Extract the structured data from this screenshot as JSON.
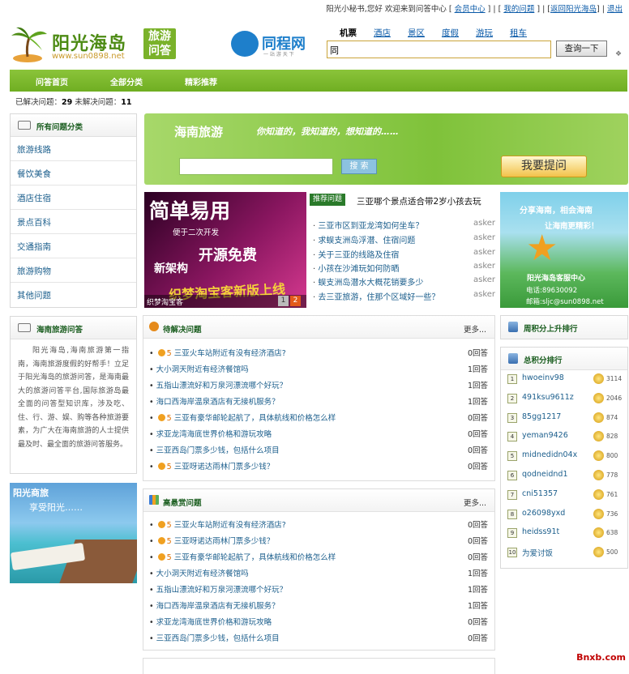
{
  "topbar": {
    "greeting": "阳光小秘书,您好 欢迎来到问答中心",
    "member_center": "会员中心",
    "my_questions": "我的问题",
    "back_home": "返回阳光海岛",
    "logout": "退出"
  },
  "header": {
    "logo_name": "阳光海岛",
    "logo_url": "www.sun0898.net",
    "badge": [
      "旅游",
      "问答"
    ],
    "partner_name": "同程网",
    "partner_slogan": "一 站 游 天 下",
    "search_tabs": [
      {
        "label": "机票",
        "active": true
      },
      {
        "label": "酒店",
        "active": false
      },
      {
        "label": "景区",
        "active": false
      },
      {
        "label": "度假",
        "active": false
      },
      {
        "label": "游玩",
        "active": false
      },
      {
        "label": "租车",
        "active": false
      }
    ],
    "search_value": "同",
    "search_button": "查询一下"
  },
  "nav": {
    "items": [
      "问答首页",
      "全部分类",
      "精彩推荐"
    ]
  },
  "stats": {
    "solved_label": "已解决问题：",
    "solved": "29",
    "unsolved_label": "未解决问题：",
    "unsolved": "11"
  },
  "categories": {
    "title": "所有问题分类",
    "items": [
      "旅游线路",
      "餐饮美食",
      "酒店住宿",
      "景点百科",
      "交通指南",
      "旅游购物",
      "其他问题"
    ]
  },
  "about": {
    "title": "海南旅游问答",
    "text": "阳光海岛,海南旅游第一指南，海南旅游度假的好帮手！立足于阳光海岛的旅游问答，是海南最大的旅游问答平台,国际旅游岛最全面的问答型知识库，涉及吃、住、行、游、娱、购等各种旅游要素，为广大在海南旅游的人士提供最及时、最全面的旅游问答服务。"
  },
  "promo": {
    "line1": "阳光商旅",
    "line2": "享受阳光……"
  },
  "banner": {
    "title": "海南旅游",
    "slogan": "你知道的，我知道的，想知道的……",
    "search_button": "搜 索",
    "ask_button": "我要提问"
  },
  "slideshow": {
    "line1": "简单易用",
    "line2": "便于二次开发",
    "line3": "开源免费",
    "line4": "新架构",
    "line5": "织梦淘宝客新版上线",
    "caption": "织梦淘宝客",
    "pages": [
      "1",
      "2"
    ]
  },
  "recommended": {
    "tag": "推荐问题",
    "headline": "三亚哪个景点适合带2岁小孩去玩",
    "items": [
      {
        "q": "三亚市区到亚龙湾如何坐车？",
        "user": "asker"
      },
      {
        "q": "求蜈支洲岛浮潜、住宿问题",
        "user": "asker"
      },
      {
        "q": "关于三亚的线路及住宿",
        "user": "asker"
      },
      {
        "q": "小孩在沙滩玩如何防晒",
        "user": "asker"
      },
      {
        "q": "蜈支洲岛潜水大概花销要多少",
        "user": "asker"
      },
      {
        "q": "去三亚旅游，住那个区域好一些？",
        "user": "asker"
      }
    ]
  },
  "right_ad": {
    "line1": "分享海南，相会海南",
    "line2": "让海南更精彩！",
    "line3": "阳光海岛客服中心",
    "line4": "电话:89630092",
    "line5": "邮箱:sljc@sun0898.net"
  },
  "pending": {
    "title": "待解决问题",
    "more": "更多...",
    "rows": [
      {
        "points": "5",
        "q": "三亚火车站附近有没有经济酒店?",
        "count": "0回答"
      },
      {
        "points": "",
        "q": "大小洞天附近有经济餐馆吗",
        "count": "1回答"
      },
      {
        "points": "",
        "q": "五指山漂流好和万泉河漂流哪个好玩？",
        "count": "1回答"
      },
      {
        "points": "",
        "q": "海口西海岸温泉酒店有无接机服务？",
        "count": "1回答"
      },
      {
        "points": "5",
        "q": "三亚有豪华邮轮起航了，具体航线和价格怎么样",
        "count": "0回答"
      },
      {
        "points": "",
        "q": "求亚龙湾海底世界价格和游玩攻略",
        "count": "0回答"
      },
      {
        "points": "",
        "q": "三亚西岛门票多少钱，包括什么项目",
        "count": "0回答"
      },
      {
        "points": "5",
        "q": "三亚呀诺达雨林门票多少钱？",
        "count": "0回答"
      }
    ]
  },
  "high": {
    "title": "高悬赏问题",
    "more": "更多...",
    "rows": [
      {
        "points": "5",
        "q": "三亚火车站附近有没有经济酒店?",
        "count": "0回答"
      },
      {
        "points": "5",
        "q": "三亚呀诺达雨林门票多少钱？",
        "count": "0回答"
      },
      {
        "points": "5",
        "q": "三亚有豪华邮轮起航了，具体航线和价格怎么样",
        "count": "0回答"
      },
      {
        "points": "",
        "q": "大小洞天附近有经济餐馆吗",
        "count": "1回答"
      },
      {
        "points": "",
        "q": "五指山漂流好和万泉河漂流哪个好玩？",
        "count": "1回答"
      },
      {
        "points": "",
        "q": "海口西海岸温泉酒店有无接机服务？",
        "count": "1回答"
      },
      {
        "points": "",
        "q": "求亚龙湾海底世界价格和游玩攻略",
        "count": "0回答"
      },
      {
        "points": "",
        "q": "三亚西岛门票多少钱，包括什么项目",
        "count": "0回答"
      }
    ]
  },
  "rise_rank": {
    "title": "周积分上升排行"
  },
  "total_rank": {
    "title": "总积分排行",
    "rows": [
      {
        "n": "1",
        "name": "hwoeinv98",
        "pts": "3114"
      },
      {
        "n": "2",
        "name": "491ksu9611z",
        "pts": "2046"
      },
      {
        "n": "3",
        "name": "85gg1217",
        "pts": "874"
      },
      {
        "n": "4",
        "name": "yeman9426",
        "pts": "828"
      },
      {
        "n": "5",
        "name": "midnedidn04x",
        "pts": "800"
      },
      {
        "n": "6",
        "name": "qodneidnd1",
        "pts": "778"
      },
      {
        "n": "7",
        "name": "cni51357",
        "pts": "761"
      },
      {
        "n": "8",
        "name": "o26098yxd",
        "pts": "736"
      },
      {
        "n": "9",
        "name": "heidss91t",
        "pts": "638"
      },
      {
        "n": "10",
        "name": "为爱讨饭",
        "pts": "500"
      }
    ]
  },
  "watermark": "Bnxb.com"
}
